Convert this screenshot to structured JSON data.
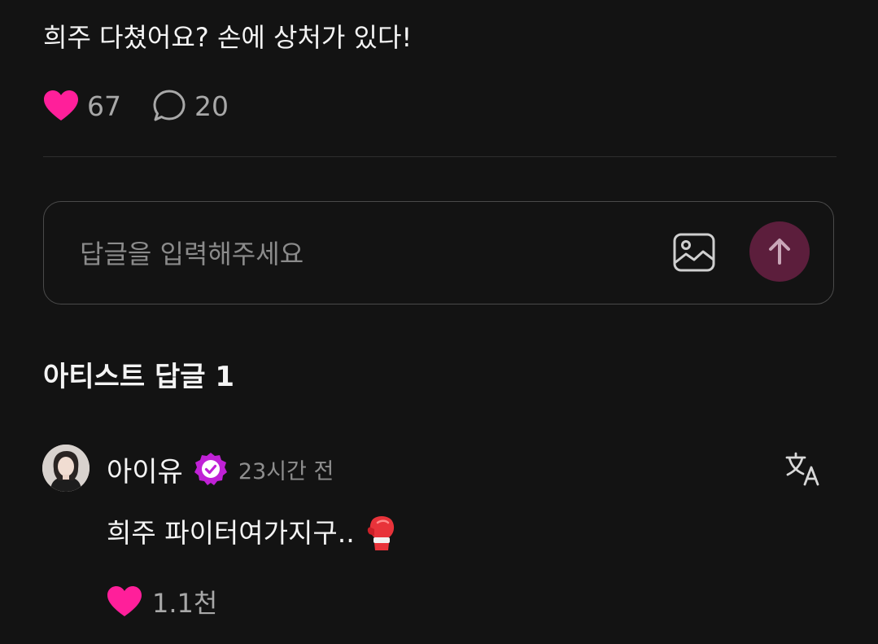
{
  "post": {
    "text": "희주 다쳤어요? 손에 상처가 있다!",
    "likes": "67",
    "comments": "20"
  },
  "reply": {
    "placeholder": "답글을 입력해주세요"
  },
  "artist_replies": {
    "title": "아티스트 답글 1"
  },
  "comment": {
    "author": "아이유",
    "time": "23시간 전",
    "text": "희주 파이터여가지구..",
    "likes": "1.1천"
  },
  "icons": {
    "like": "heart-icon",
    "comment": "speech-bubble-icon",
    "image": "image-icon",
    "send": "arrow-up-icon",
    "verified": "verified-badge-icon",
    "translate": "translate-icon",
    "emoji": "boxing-glove-emoji"
  },
  "colors": {
    "background": "#131313",
    "heart": "#ff1f9a",
    "send_button": "#5c1e3c",
    "verified": "#c021d6"
  }
}
